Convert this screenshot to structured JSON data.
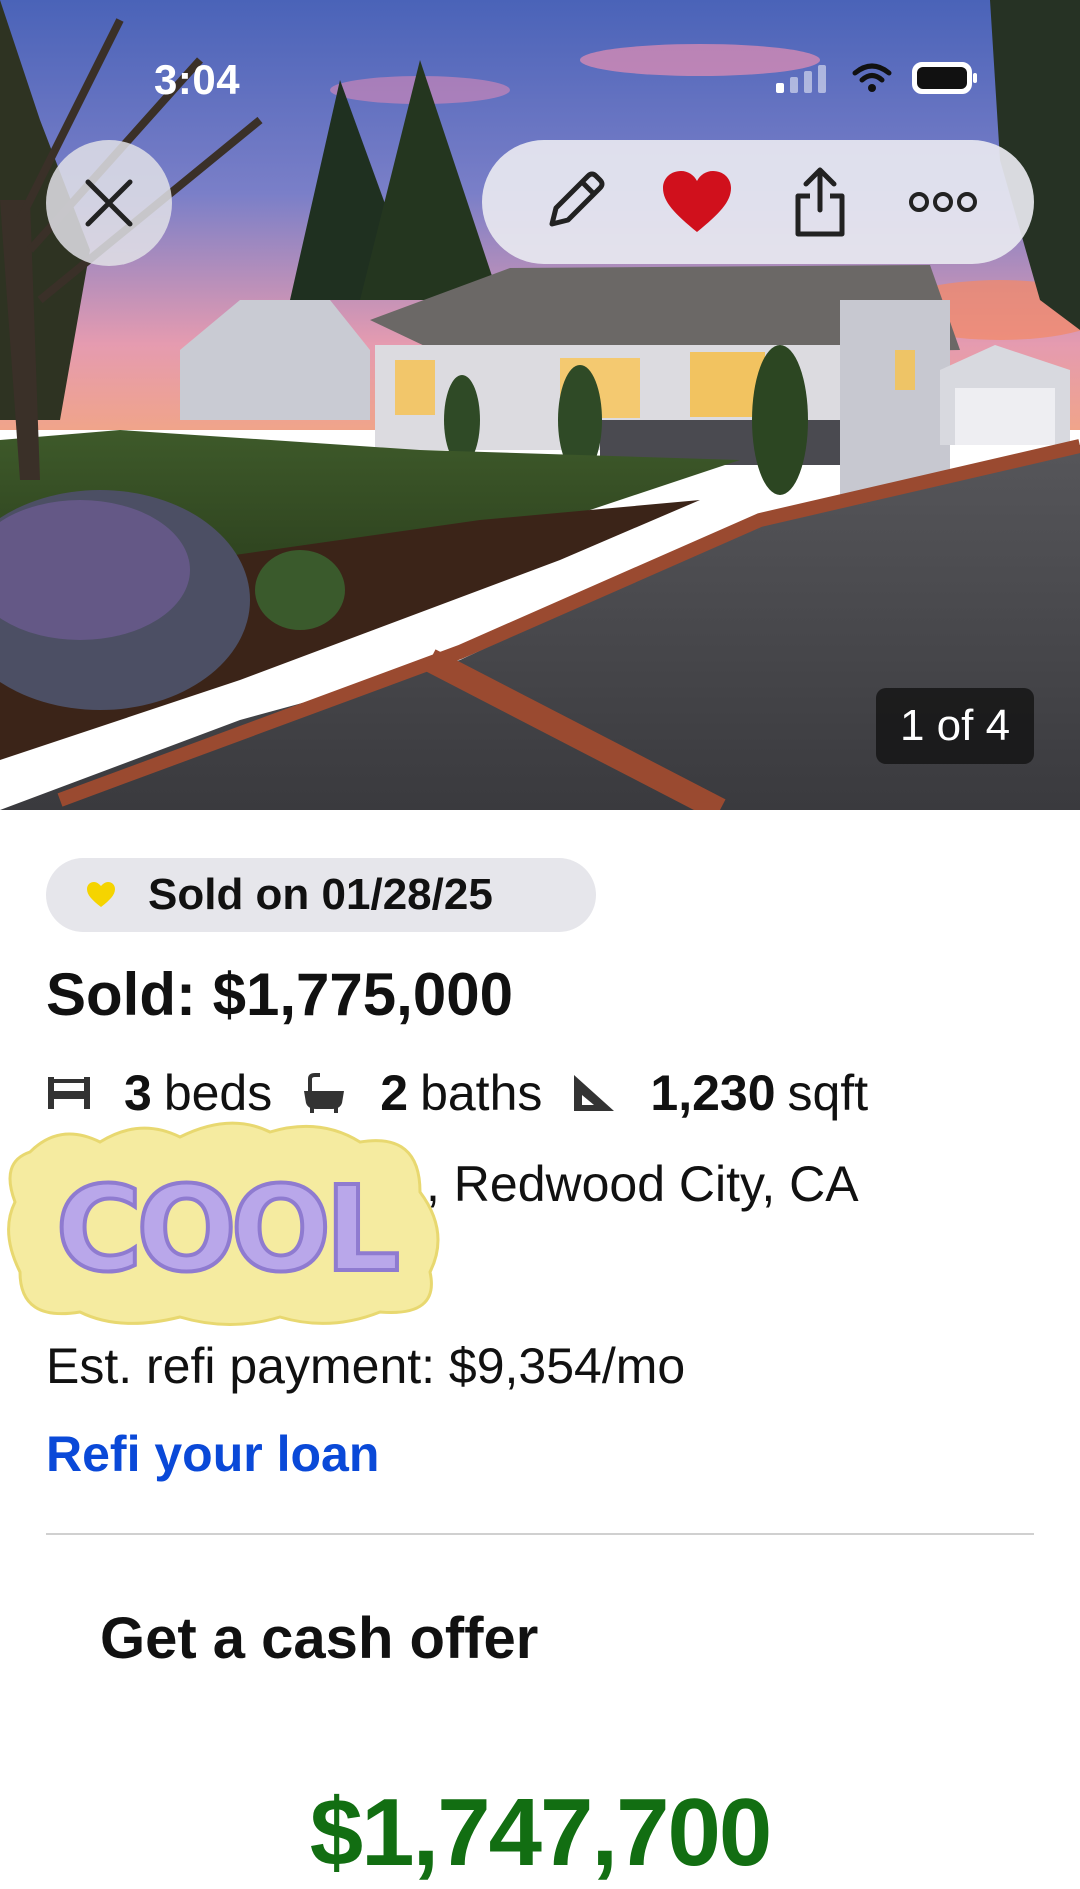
{
  "status_bar": {
    "time": "3:04"
  },
  "toolbar": {
    "close_icon": "close-icon",
    "edit_icon": "pencil-icon",
    "favorite_icon": "heart-icon",
    "favorite_color": "#d0101c",
    "share_icon": "share-icon",
    "more_icon": "more-icon"
  },
  "gallery": {
    "counter": "1 of 4"
  },
  "listing": {
    "sold_badge": "Sold on 01/28/25",
    "price": "Sold: $1,775,000",
    "beds_value": "3",
    "beds_label": "beds",
    "baths_value": "2",
    "baths_label": "baths",
    "sqft_value": "1,230",
    "sqft_label": "sqft",
    "address_visible": ", Redwood City, CA"
  },
  "refi": {
    "payment": "Est. refi payment: $9,354/mo",
    "link": "Refi your loan"
  },
  "cash_offer": {
    "title": "Get a cash offer",
    "value": "$1,747,700"
  },
  "sticker": {
    "text": "COOL"
  },
  "colors": {
    "link": "#0a49d8",
    "cash_value": "#126e12",
    "badge_heart": "#f5d400"
  }
}
